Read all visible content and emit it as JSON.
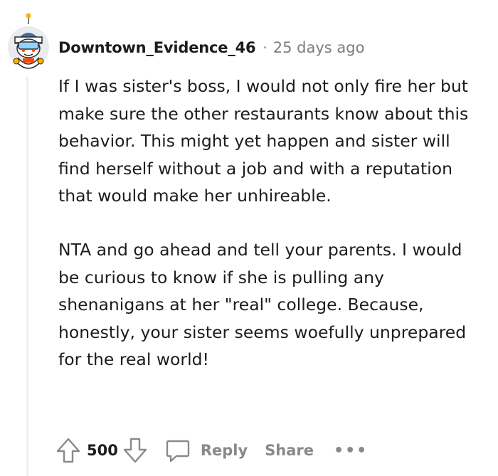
{
  "comment": {
    "author": "Downtown_Evidence_46",
    "separator": "·",
    "time_ago": "25 days ago",
    "paragraphs": [
      "If I was sister's boss, I would not only fire her but make sure the other restaurants know about this behavior. This might yet happen and sister will find herself without a job and with a reputation that would make her unhireable.",
      "NTA and go ahead and tell your parents. I would be curious to know if she is pulling any shenanigans at her \"real\" college. Because, honestly, your sister seems woefully unprepared for the real world!"
    ],
    "score": "500",
    "reply_label": "Reply",
    "share_label": "Share",
    "more_label": "•••"
  },
  "icons": {
    "avatar": "snoo-avatar-icon",
    "upvote": "upvote-arrow-icon",
    "downvote": "downvote-arrow-icon",
    "reply": "speech-bubble-icon",
    "more": "more-options-icon"
  },
  "colors": {
    "text": "#1c1c1c",
    "muted": "#7c7c7c",
    "action_gray": "#878a8c",
    "thread_line": "#edeff1"
  }
}
